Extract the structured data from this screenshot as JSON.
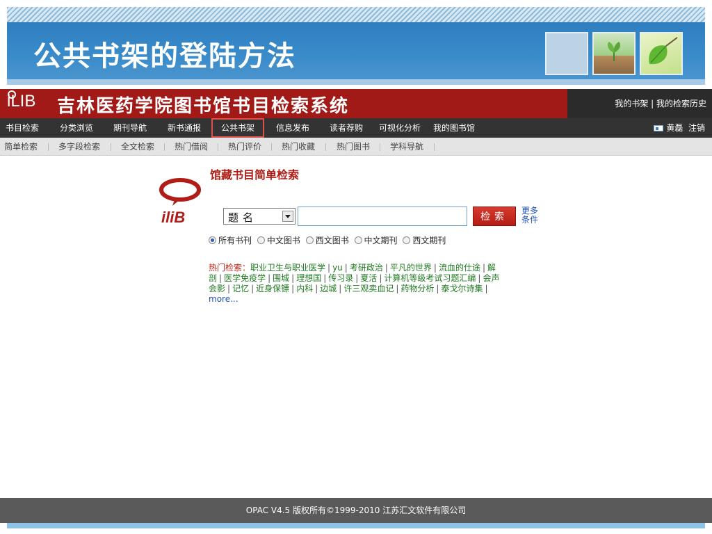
{
  "slide": {
    "title": "公共书架的登陆方法"
  },
  "header": {
    "logo_text": "iLIB",
    "system_title": "吉林医药学院图书馆书目检索系统",
    "right_links": "我的书架 | 我的检索历史"
  },
  "main_nav": {
    "items": [
      "书目检索",
      "分类浏览",
      "期刊导航",
      "新书通报",
      "公共书架",
      "信息发布",
      "读者荐购",
      "可视化分析",
      "我的图书馆"
    ],
    "active": "公共书架",
    "user_name": "黄磊",
    "logout": "注销"
  },
  "sub_nav": {
    "items": [
      "简单检索",
      "多字段检索",
      "全文检索",
      "热门借阅",
      "热门评价",
      "热门收藏",
      "热门图书",
      "学科导航"
    ]
  },
  "search": {
    "logo_text": "iliB",
    "heading": "馆藏书目简单检索",
    "field_selected": "题名",
    "query_value": "",
    "button": "检索",
    "more_conditions": "更多条件",
    "doc_types": [
      "所有书刊",
      "中文图书",
      "西文图书",
      "中文期刊",
      "西文期刊"
    ],
    "doc_type_selected": "所有书刊"
  },
  "hot_search": {
    "label": "热门检索：",
    "terms": [
      "职业卫生与职业医学",
      "yu",
      "考研政治",
      "平凡的世界",
      "流血的仕途",
      "解剖",
      "医学免疫学",
      "围城",
      "理想国",
      "传习录",
      "夏活",
      "计算机等级考试习题汇编",
      "会声会影",
      "记忆",
      "近身保镖",
      "内科",
      "边城",
      "许三观卖血记",
      "药物分析",
      "泰戈尔诗集"
    ],
    "more": "more..."
  },
  "footer": {
    "text": "OPAC V4.5    版权所有©1999-2010 江苏汇文软件有限公司"
  },
  "colors": {
    "brand_red": "#a21a17",
    "nav_dark": "#333333",
    "banner_blue": "#2f7fc0",
    "link_green": "#1f7a20"
  }
}
